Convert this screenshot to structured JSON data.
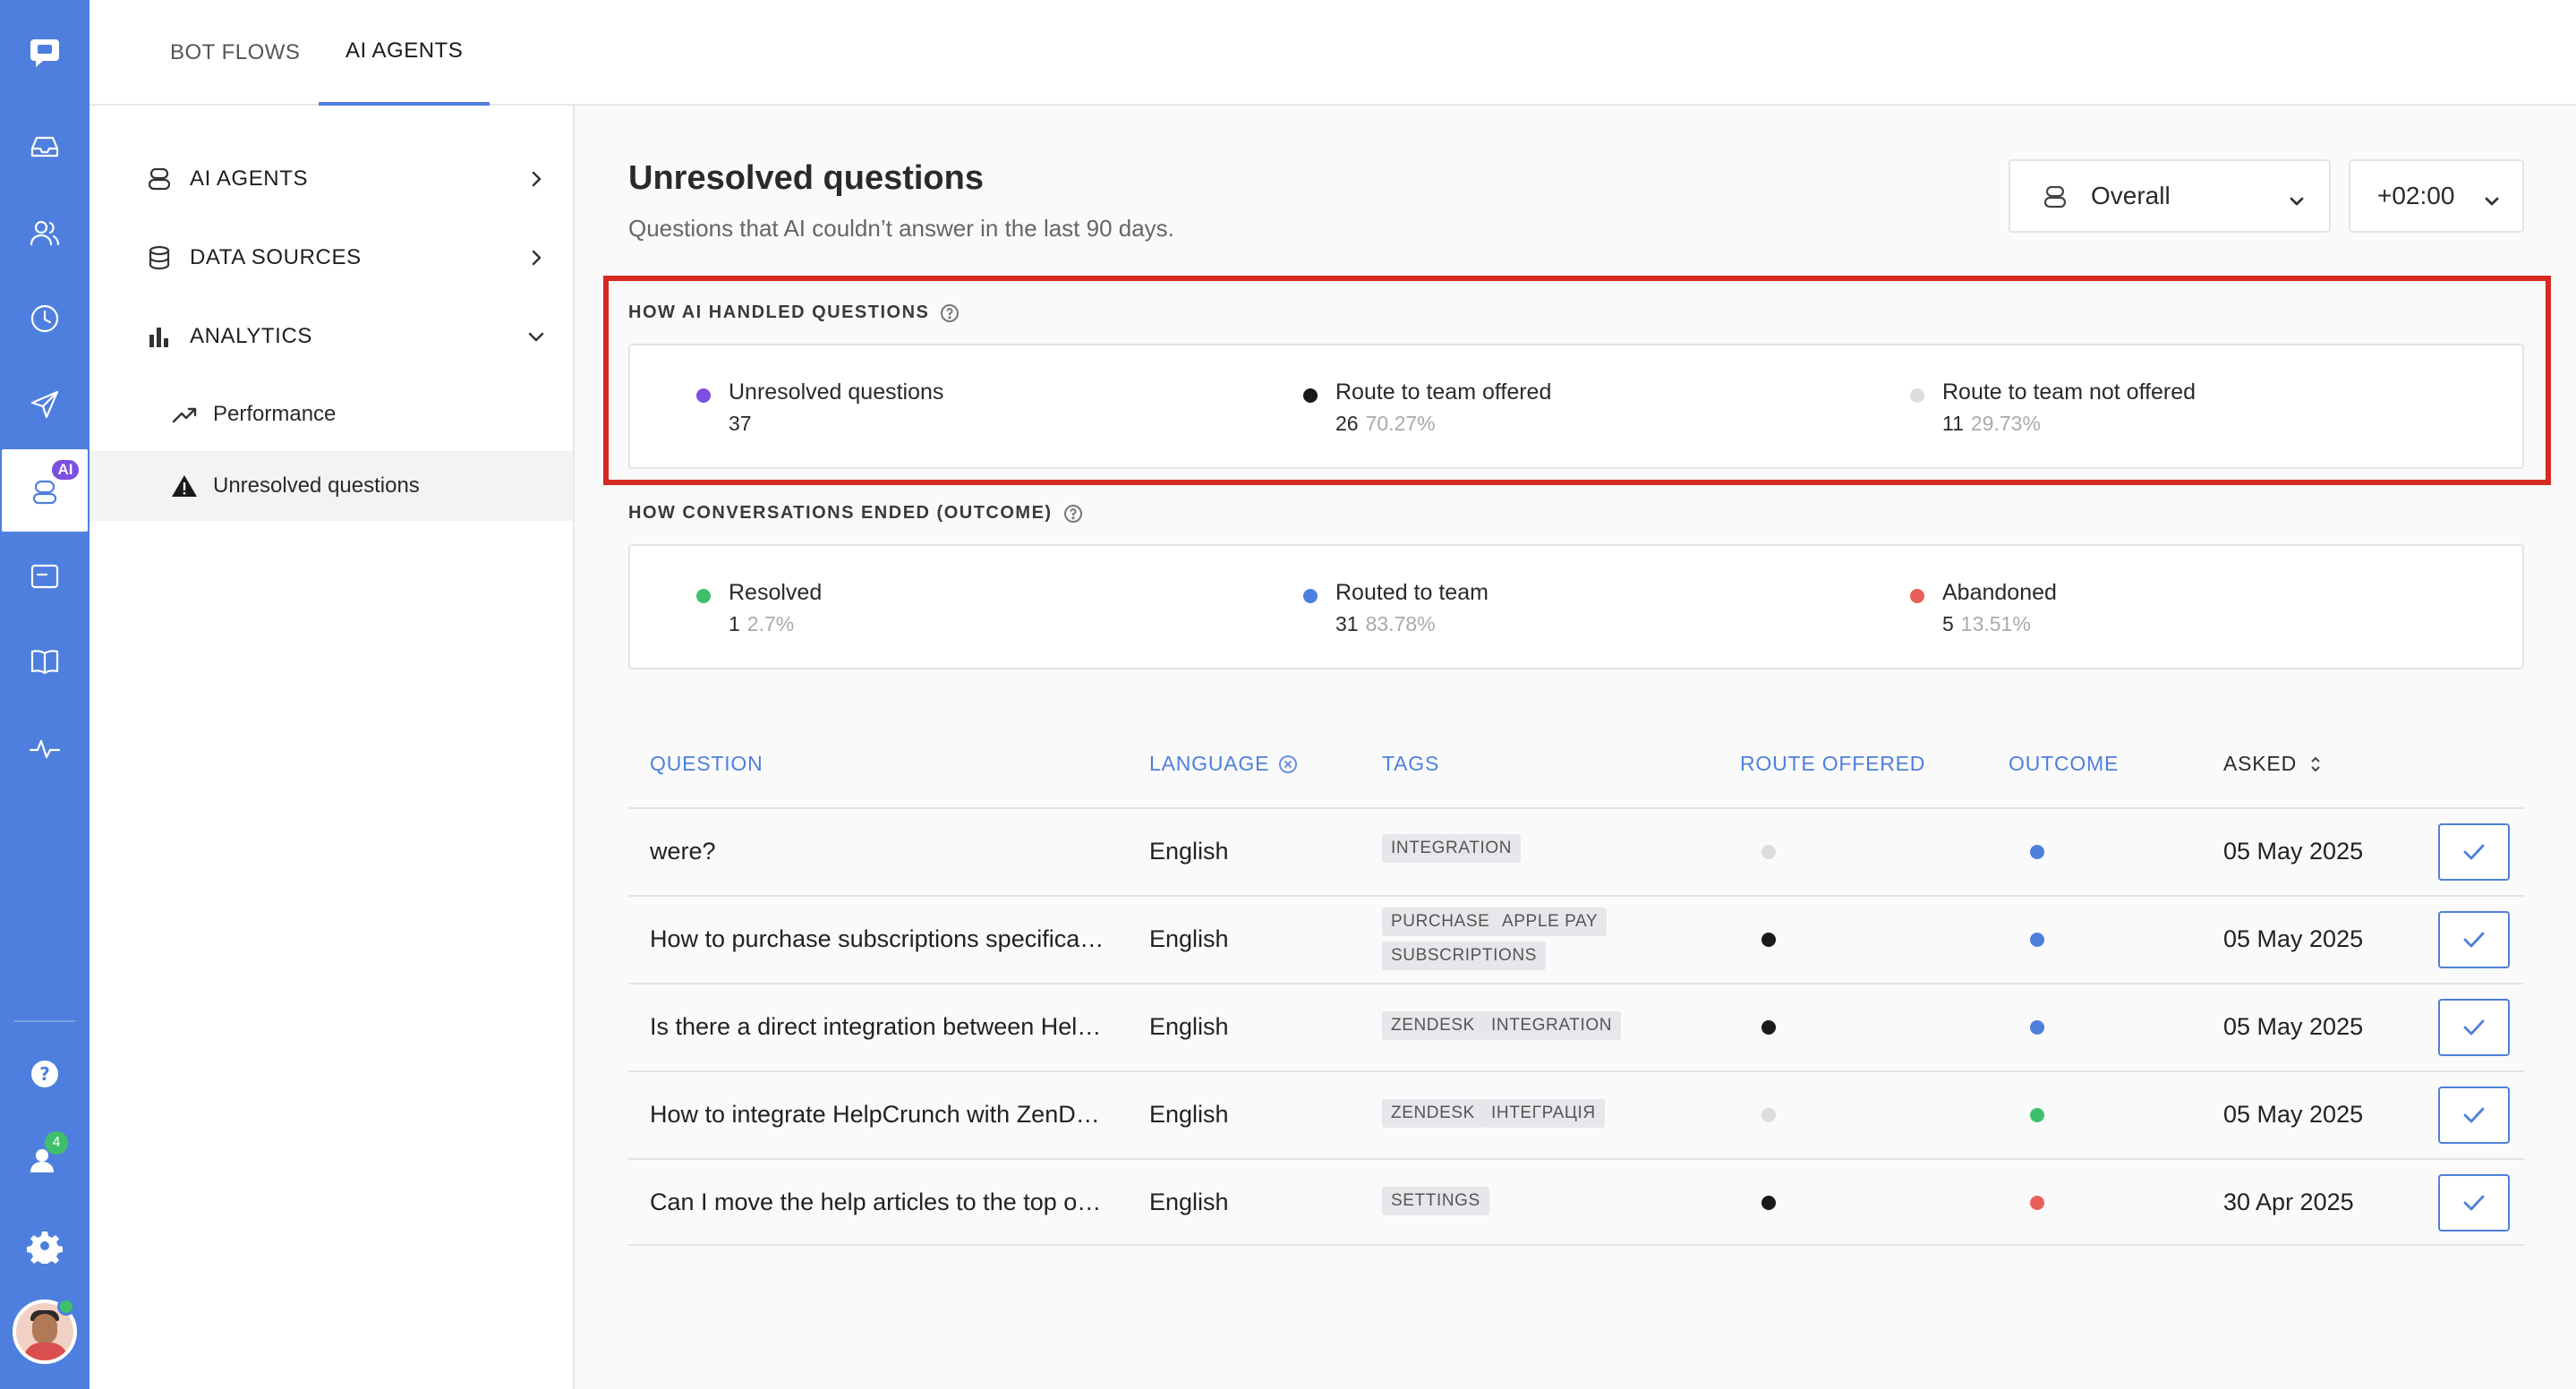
{
  "colors": {
    "brand": "#4e7fde",
    "highlight": "#d42a20",
    "unresolved_purple": "#7b4fe0",
    "dark_dot": "#1a1a1a",
    "light_dot": "#dddddd",
    "green": "#3fbf6a",
    "blue": "#4e7fde",
    "red": "#e8605a"
  },
  "rail": {
    "ai_badge": "AI",
    "contacts_badge": "4",
    "items": [
      "chat-logo-icon",
      "inbox-icon",
      "contacts-icon",
      "clock-icon",
      "send-icon",
      "ai-agent-icon",
      "widget-icon",
      "knowledge-book-icon",
      "activity-icon",
      "help-icon",
      "team-icon",
      "settings-icon"
    ]
  },
  "topbar": {
    "tabs": [
      {
        "label": "BOT FLOWS"
      },
      {
        "label": "AI AGENTS"
      }
    ]
  },
  "nav": {
    "ai_agents": "AI AGENTS",
    "data_sources": "DATA SOURCES",
    "analytics": "ANALYTICS",
    "performance": "Performance",
    "unresolved": "Unresolved questions"
  },
  "header": {
    "title": "Unresolved questions",
    "subtitle": "Questions that AI couldn’t answer in the last 90 days.",
    "scope_select": "Overall",
    "timezone_select": "+02:00"
  },
  "handled": {
    "label": "HOW AI HANDLED QUESTIONS",
    "stats": [
      {
        "label": "Unresolved questions",
        "value": "37",
        "pct": ""
      },
      {
        "label": "Route to team offered",
        "value": "26",
        "pct": "70.27%"
      },
      {
        "label": "Route to team not offered",
        "value": "11",
        "pct": "29.73%"
      }
    ]
  },
  "outcome": {
    "label": "HOW CONVERSATIONS ENDED (OUTCOME)",
    "stats": [
      {
        "label": "Resolved",
        "value": "1",
        "pct": "2.7%"
      },
      {
        "label": "Routed to team",
        "value": "31",
        "pct": "83.78%"
      },
      {
        "label": "Abandoned",
        "value": "5",
        "pct": "13.51%"
      }
    ]
  },
  "table": {
    "headers": {
      "question": "QUESTION",
      "language": "LANGUAGE",
      "tags": "TAGS",
      "route": "ROUTE OFFERED",
      "outcome": "OUTCOME",
      "asked": "ASKED"
    },
    "rows": [
      {
        "question": "were?",
        "language": "English",
        "tags": [
          "INTEGRATION"
        ],
        "route": "not-offered",
        "outcome": "routed",
        "asked": "05 May 2025"
      },
      {
        "question": "How to purchase subscriptions specifica…",
        "language": "English",
        "tags": [
          "PURCHASE",
          "APPLE PAY",
          "SUBSCRIPTIONS"
        ],
        "route": "offered",
        "outcome": "routed",
        "asked": "05 May 2025"
      },
      {
        "question": "Is there a direct integration between Hel…",
        "language": "English",
        "tags": [
          "ZENDESK",
          "INTEGRATION"
        ],
        "route": "offered",
        "outcome": "routed",
        "asked": "05 May 2025"
      },
      {
        "question": "How to integrate HelpCrunch with ZenD…",
        "language": "English",
        "tags": [
          "ZENDESK",
          "ІНТЕГРАЦІЯ"
        ],
        "route": "not-offered",
        "outcome": "resolved",
        "asked": "05 May 2025"
      },
      {
        "question": "Can I move the help articles to the top o…",
        "language": "English",
        "tags": [
          "SETTINGS"
        ],
        "route": "offered",
        "outcome": "abandoned",
        "asked": "30 Apr 2025"
      }
    ]
  }
}
